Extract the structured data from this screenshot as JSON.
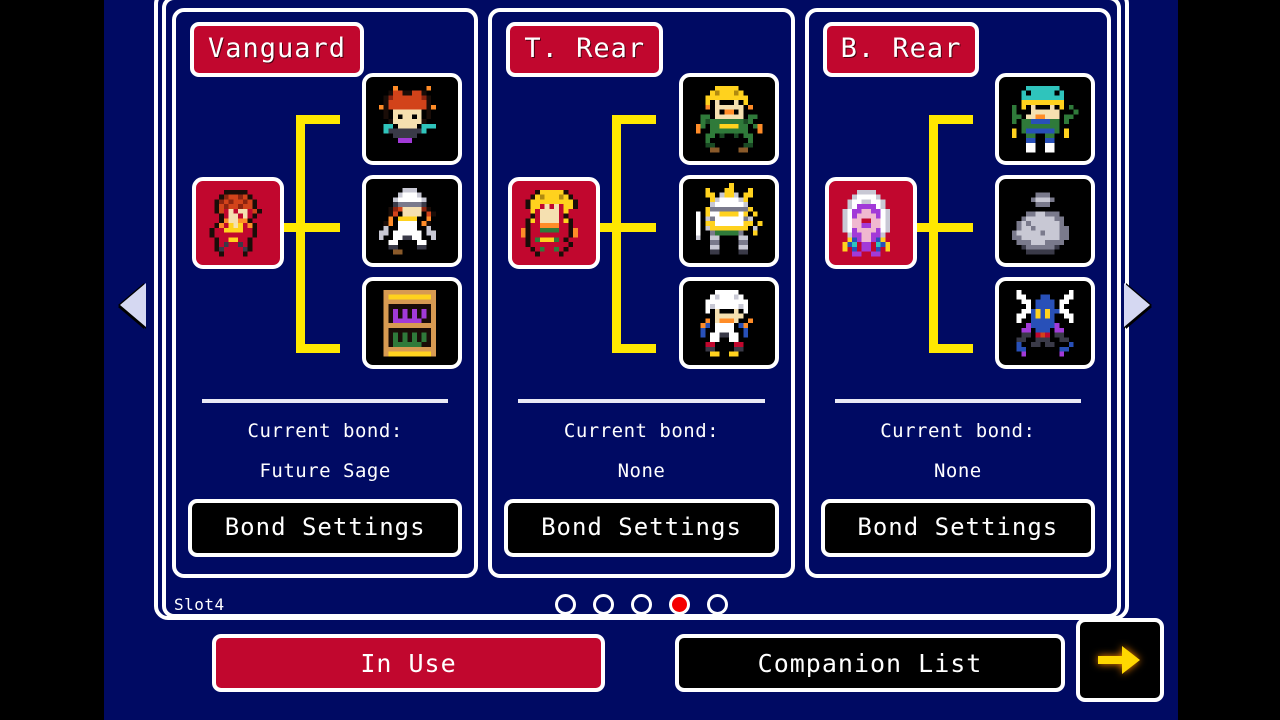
{
  "screen": {
    "background_color": "#000a63",
    "letterbox_color": "#000000",
    "accent_red": "#c1072e",
    "connector_yellow": "#ffe800",
    "border_white": "#ffffff"
  },
  "nav": {
    "left_arrow": "left-triangle-icon",
    "right_arrow": "right-triangle-icon"
  },
  "panels": [
    {
      "title": "Vanguard",
      "leader": {
        "sprite": "red-haired-swordsman-sprite",
        "slot_color": "#c1072e"
      },
      "members": [
        {
          "sprite": "orange-haired-girl-sprite"
        },
        {
          "sprite": "white-helmet-knight-sprite"
        },
        {
          "sprite": "potion-shelf-sprite"
        }
      ],
      "bond_label": "Current bond:",
      "bond_value": "Future Sage",
      "button_label": "Bond Settings"
    },
    {
      "title": "T. Rear",
      "leader": {
        "sprite": "blonde-mage-sprite",
        "slot_color": "#c1072e"
      },
      "members": [
        {
          "sprite": "green-armor-elf-sprite"
        },
        {
          "sprite": "gold-helm-paladin-sprite"
        },
        {
          "sprite": "white-haired-cleric-sprite"
        }
      ],
      "bond_label": "Current bond:",
      "bond_value": "None",
      "button_label": "Bond Settings"
    },
    {
      "title": "B. Rear",
      "leader": {
        "sprite": "purple-ghost-knight-sprite",
        "slot_color": "#c1072e"
      },
      "members": [
        {
          "sprite": "teal-cap-adventurer-sprite"
        },
        {
          "sprite": "grey-boulder-golem-sprite"
        },
        {
          "sprite": "blue-winged-spirit-sprite"
        }
      ],
      "bond_label": "Current bond:",
      "bond_value": "None",
      "button_label": "Bond Settings"
    }
  ],
  "slotbar": {
    "label": "Slot4",
    "dot_count": 5,
    "active_index": 3,
    "active_color": "#f50000"
  },
  "bottom": {
    "in_use_label": "In Use",
    "companion_list_label": "Companion List",
    "next_button_icon": "right-arrow-icon",
    "next_arrow_color": "#ffd700"
  }
}
